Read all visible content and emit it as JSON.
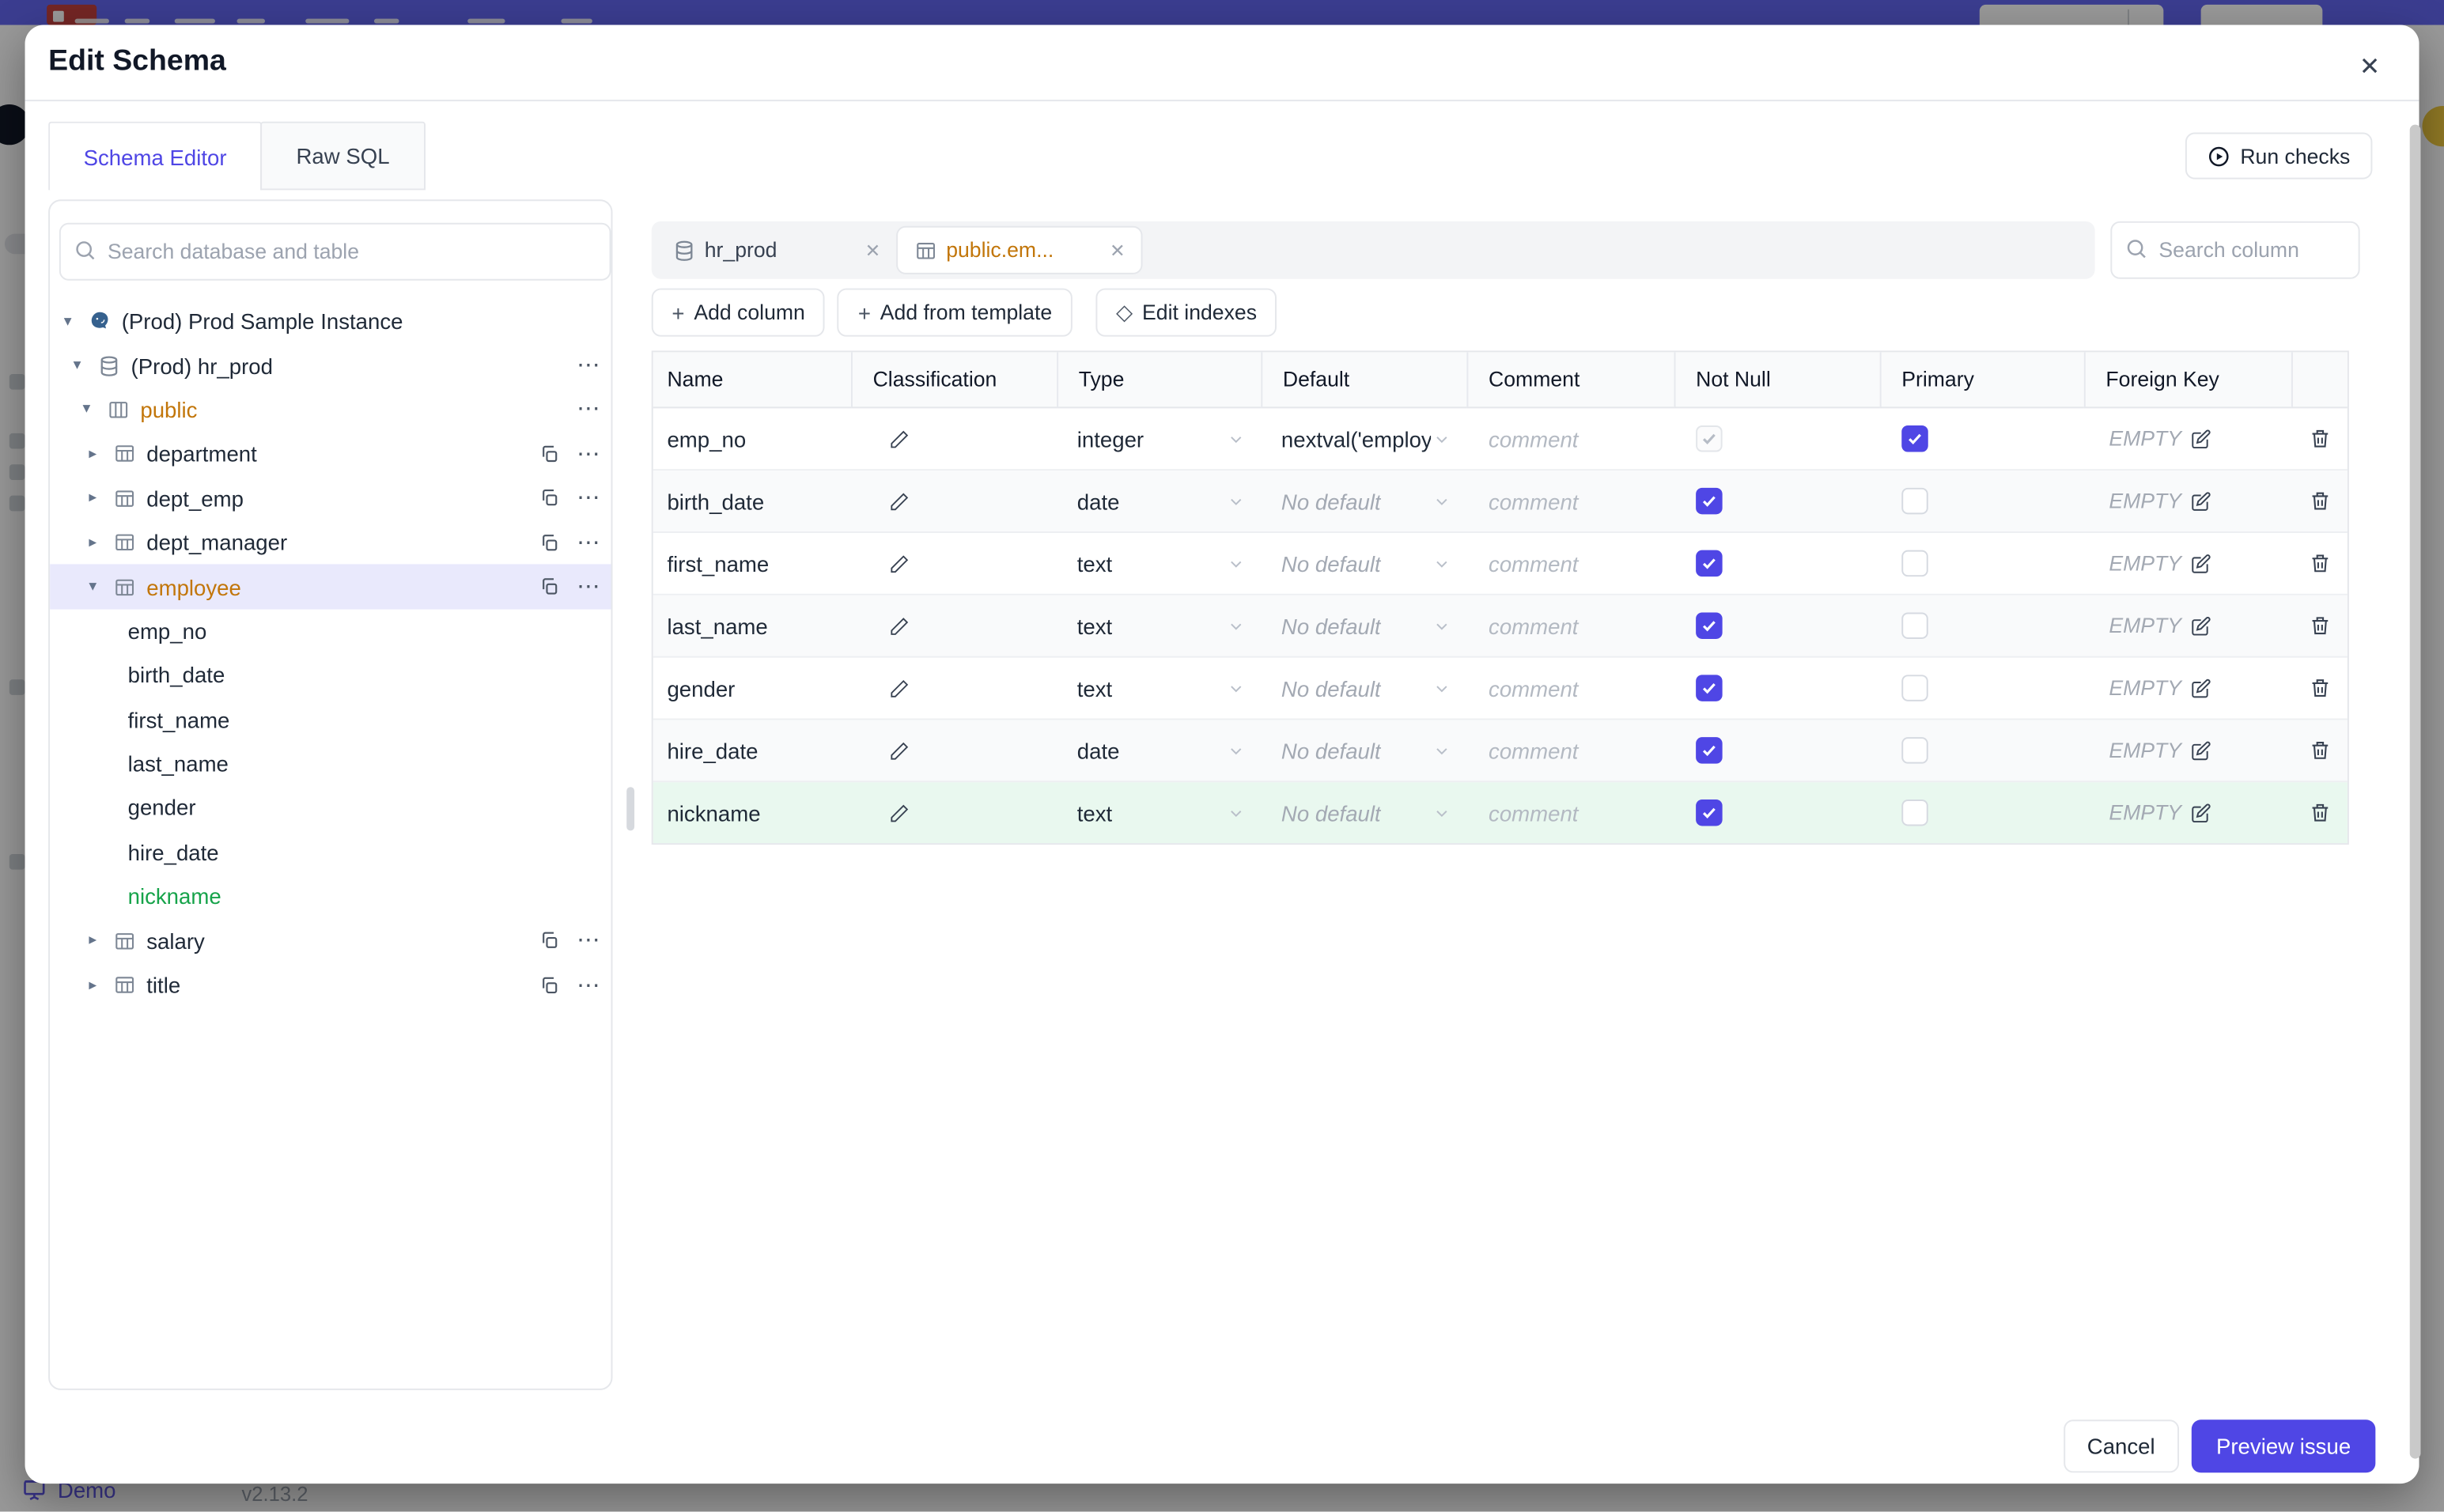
{
  "colors": {
    "accent": "#4f46e5",
    "topbar": "#6366f1",
    "amber_changed": "#c2760a",
    "green_added": "#16a34a",
    "green_row_bg": "#e9f8ef",
    "selected_tree_bg": "#e9e9fc"
  },
  "chrome": {
    "demo_label": "Demo",
    "version": "v2.13.2"
  },
  "modal": {
    "title": "Edit Schema",
    "tabs": [
      {
        "label": "Schema Editor",
        "active": true
      },
      {
        "label": "Raw SQL",
        "active": false
      }
    ],
    "run_checks_label": "Run checks"
  },
  "sidebar": {
    "search_placeholder": "Search database and table",
    "tree": [
      {
        "label": "(Prod) Prod Sample Instance",
        "level": 0,
        "icon": "postgres",
        "caret": "down"
      },
      {
        "label": "(Prod) hr_prod",
        "level": 1,
        "icon": "database",
        "caret": "down",
        "ellipsis": true
      },
      {
        "label": "public",
        "level": 2,
        "icon": "schema",
        "caret": "down",
        "ellipsis": true,
        "color": "amber"
      },
      {
        "label": "department",
        "level": 3,
        "icon": "table",
        "caret": "right",
        "copy": true,
        "ellipsis": true
      },
      {
        "label": "dept_emp",
        "level": 3,
        "icon": "table",
        "caret": "right",
        "copy": true,
        "ellipsis": true
      },
      {
        "label": "dept_manager",
        "level": 3,
        "icon": "table",
        "caret": "right",
        "copy": true,
        "ellipsis": true
      },
      {
        "label": "employee",
        "level": 3,
        "icon": "table",
        "caret": "down",
        "copy": true,
        "ellipsis": true,
        "color": "amber",
        "selected": true
      },
      {
        "label": "emp_no",
        "level": 4
      },
      {
        "label": "birth_date",
        "level": 4
      },
      {
        "label": "first_name",
        "level": 4
      },
      {
        "label": "last_name",
        "level": 4
      },
      {
        "label": "gender",
        "level": 4
      },
      {
        "label": "hire_date",
        "level": 4
      },
      {
        "label": "nickname",
        "level": 4,
        "color": "green"
      },
      {
        "label": "salary",
        "level": 3,
        "icon": "table",
        "caret": "right",
        "copy": true,
        "ellipsis": true
      },
      {
        "label": "title",
        "level": 3,
        "icon": "table",
        "caret": "right",
        "copy": true,
        "ellipsis": true
      }
    ]
  },
  "editor": {
    "tabs": [
      {
        "label": "hr_prod",
        "icon": "database",
        "active": false
      },
      {
        "label": "public.em...",
        "icon": "table",
        "active": true,
        "color": "amber"
      }
    ],
    "column_search_placeholder": "Search column",
    "actions": [
      {
        "icon": "plus",
        "label": "Add column"
      },
      {
        "icon": "plus",
        "label": "Add from template"
      },
      {
        "icon": "diamond",
        "label": "Edit indexes"
      }
    ],
    "table": {
      "columns": [
        "Name",
        "Classification",
        "Type",
        "Default",
        "Comment",
        "Not Null",
        "Primary",
        "Foreign Key",
        ""
      ],
      "comment_placeholder": "comment",
      "foreign_key_empty": "EMPTY",
      "rows": [
        {
          "name": "emp_no",
          "type": "integer",
          "default": "nextval('employ",
          "default_is_placeholder": false,
          "not_null_checked": true,
          "not_null_disabled": true,
          "primary_checked": true
        },
        {
          "name": "birth_date",
          "type": "date",
          "default": "No default",
          "default_is_placeholder": true,
          "not_null_checked": true,
          "not_null_disabled": false,
          "primary_checked": false
        },
        {
          "name": "first_name",
          "type": "text",
          "default": "No default",
          "default_is_placeholder": true,
          "not_null_checked": true,
          "not_null_disabled": false,
          "primary_checked": false
        },
        {
          "name": "last_name",
          "type": "text",
          "default": "No default",
          "default_is_placeholder": true,
          "not_null_checked": true,
          "not_null_disabled": false,
          "primary_checked": false
        },
        {
          "name": "gender",
          "type": "text",
          "default": "No default",
          "default_is_placeholder": true,
          "not_null_checked": true,
          "not_null_disabled": false,
          "primary_checked": false
        },
        {
          "name": "hire_date",
          "type": "date",
          "default": "No default",
          "default_is_placeholder": true,
          "not_null_checked": true,
          "not_null_disabled": false,
          "primary_checked": false
        },
        {
          "name": "nickname",
          "type": "text",
          "default": "No default",
          "default_is_placeholder": true,
          "not_null_checked": true,
          "not_null_disabled": false,
          "primary_checked": false,
          "highlight": "green"
        }
      ]
    }
  },
  "footer": {
    "cancel_label": "Cancel",
    "submit_label": "Preview issue"
  }
}
